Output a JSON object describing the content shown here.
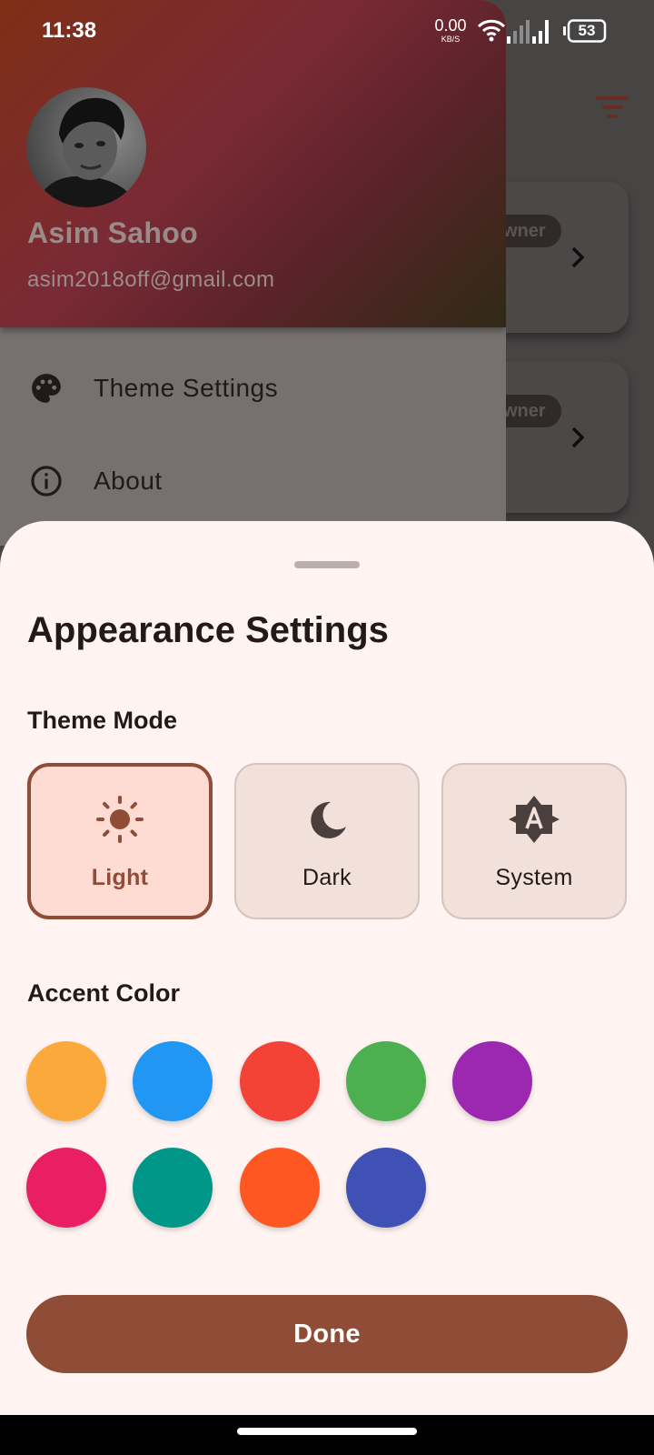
{
  "status_bar": {
    "time": "11:38",
    "net_speed_value": "0.00",
    "net_speed_unit": "KB/S",
    "battery_level": "53"
  },
  "background": {
    "owner_badge": "Owner",
    "owner_badge_visible": "wner"
  },
  "drawer": {
    "profile": {
      "name": "Asim Sahoo",
      "email": "asim2018off@gmail.com"
    },
    "items": [
      {
        "label": "Theme Settings",
        "icon": "palette-icon"
      },
      {
        "label": "About",
        "icon": "info-icon"
      }
    ]
  },
  "sheet": {
    "title": "Appearance Settings",
    "theme_mode_label": "Theme Mode",
    "modes": [
      {
        "label": "Light",
        "icon": "sun-icon",
        "selected": true
      },
      {
        "label": "Dark",
        "icon": "moon-icon",
        "selected": false
      },
      {
        "label": "System",
        "icon": "auto-brightness-icon",
        "selected": false
      }
    ],
    "accent_color_label": "Accent Color",
    "accent_colors": [
      "#fba93b",
      "#2196f3",
      "#f44336",
      "#4caf50",
      "#9c27b0",
      "#e91e63",
      "#009688",
      "#ff5722",
      "#3f51b5"
    ],
    "done_label": "Done"
  },
  "colors": {
    "primary": "#8f4c37",
    "sheet_background": "#fff4f2",
    "selected_card": "#ffdcd3",
    "unselected_card": "#f2e0da"
  }
}
